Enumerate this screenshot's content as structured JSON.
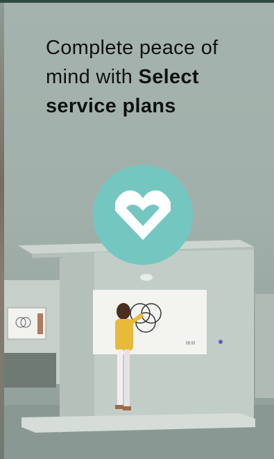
{
  "headline": {
    "line_1": "Complete peace of",
    "line_2": "mind with",
    "line_2_bold": "Select",
    "line_3_bold": "service plans"
  },
  "whiteboard_label": "||||| ||||",
  "badge": {
    "icon": "heart-icon",
    "color": "#74c7c1"
  }
}
